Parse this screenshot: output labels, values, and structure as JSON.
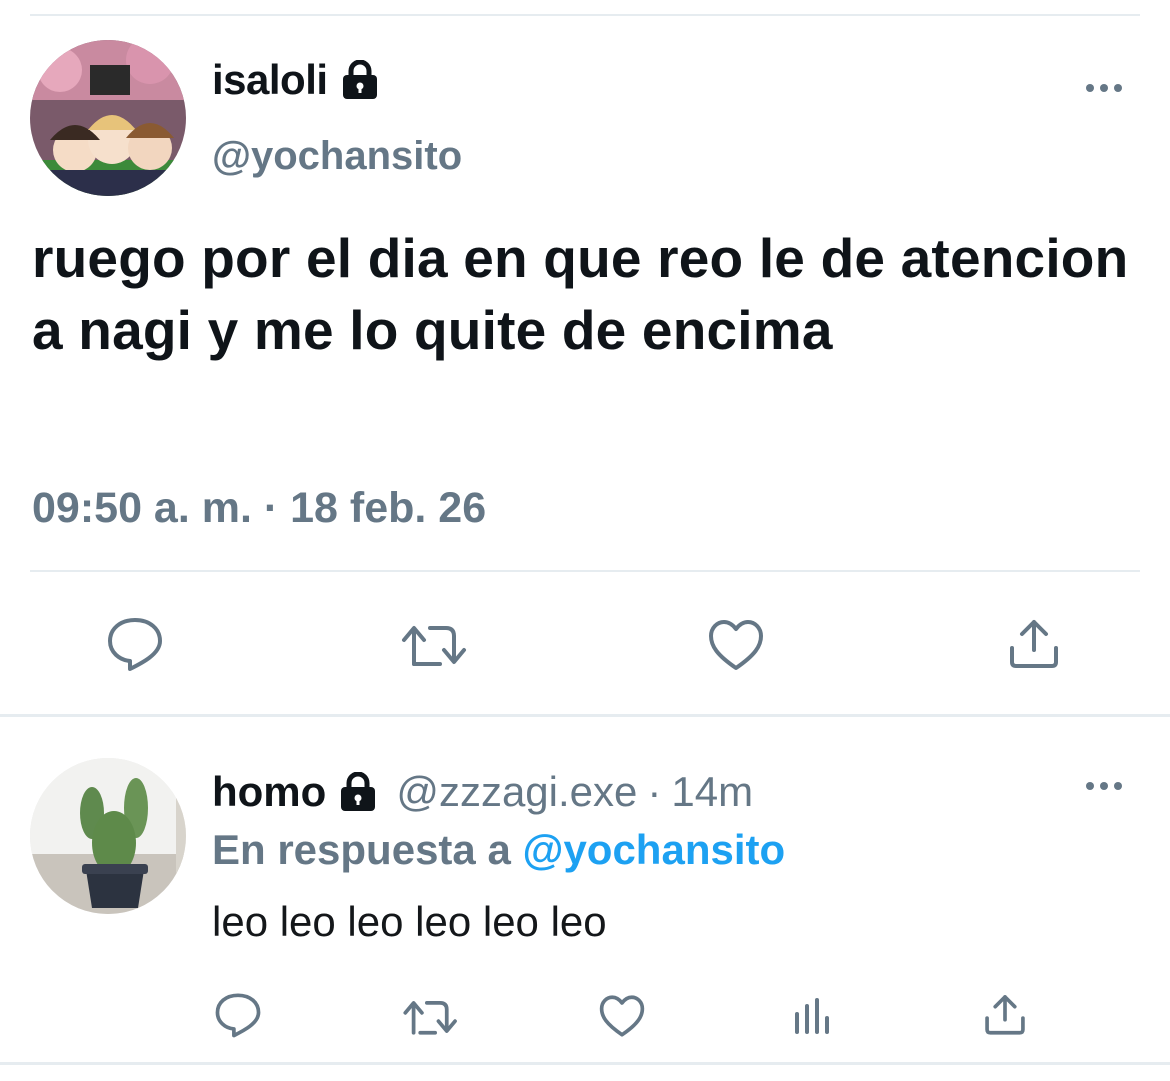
{
  "main_tweet": {
    "display_name": "isaloli",
    "handle": "@yochansito",
    "text": "ruego por el dia en que reo le de atencion a nagi y me lo quite de encima",
    "timestamp": "09:50 a. m. · 18 feb. 26",
    "icons": [
      "lock-icon",
      "more-icon",
      "reply-icon",
      "retweet-icon",
      "like-icon",
      "share-icon"
    ]
  },
  "reply_tweet": {
    "display_name": "homo",
    "handle": "@zzzagi.exe",
    "dot": "·",
    "time": "14m",
    "replying_prefix": "En respuesta a",
    "replying_to": "@yochansito",
    "text": "leo leo leo leo leo leo",
    "icons": [
      "lock-icon",
      "more-icon",
      "reply-icon",
      "retweet-icon",
      "like-icon",
      "analytics-icon",
      "share-icon"
    ]
  },
  "colors": {
    "text": "#0f1419",
    "secondary": "#657786",
    "link": "#1da1f2",
    "divider": "#e6ecf0"
  }
}
